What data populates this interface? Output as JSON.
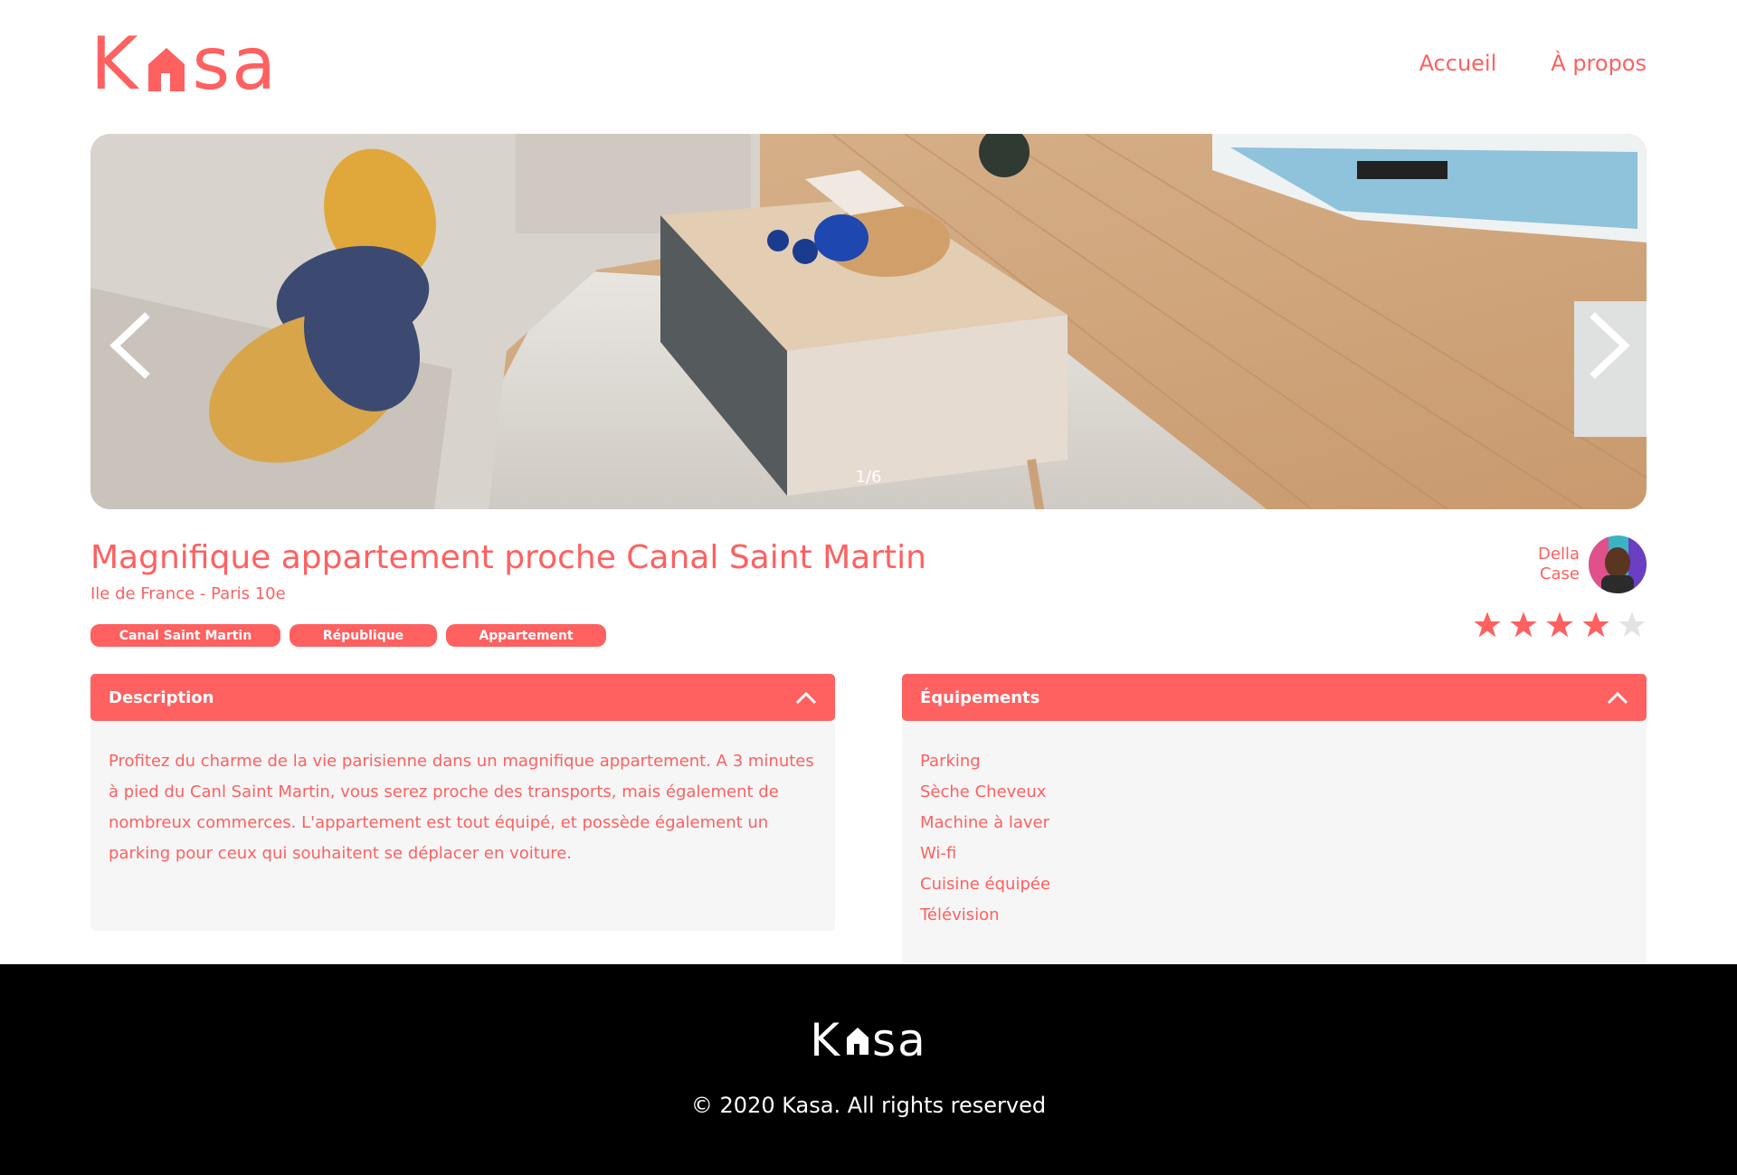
{
  "brand": {
    "logo_left": "K",
    "logo_right": "sa",
    "accent_color": "#FF6060"
  },
  "nav": {
    "home": "Accueil",
    "about": "À propos"
  },
  "carousel": {
    "counter": "1/6",
    "prev_icon": "chevron-left-icon",
    "next_icon": "chevron-right-icon"
  },
  "listing": {
    "title": "Magnifique appartement proche Canal Saint Martin",
    "location": "Ile de France - Paris 10e",
    "tags": [
      "Canal Saint Martin",
      "République",
      "Appartement"
    ]
  },
  "host": {
    "first_name": "Della",
    "last_name": "Case"
  },
  "rating": {
    "value": 4,
    "max": 5
  },
  "description": {
    "label": "Description",
    "text": "Profitez du charme de la vie parisienne dans un magnifique appartement. A 3 minutes à pied du Canl Saint Martin, vous serez proche des transports, mais également de nombreux commerces. L'appartement est tout équipé, et possède également un parking pour ceux qui souhaitent se déplacer en voiture."
  },
  "equipments": {
    "label": "Équipements",
    "items": [
      "Parking",
      "Sèche Cheveux",
      "Machine à laver",
      "Wi-fi",
      "Cuisine équipée",
      "Télévision"
    ]
  },
  "footer": {
    "logo_left": "K",
    "logo_right": "sa",
    "copyright": "© 2020 Kasa. All rights reserved"
  }
}
